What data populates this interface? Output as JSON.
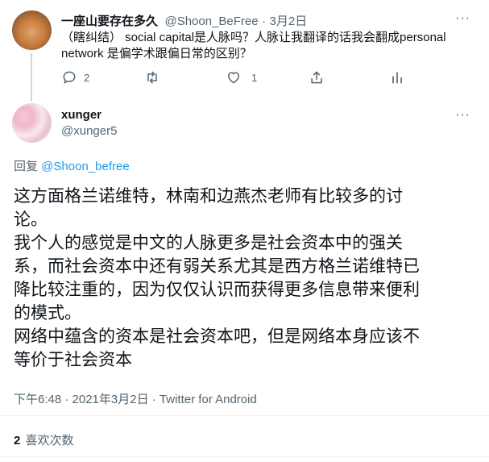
{
  "parent": {
    "display_name": "一座山要存在多久",
    "handle": "@Shoon_BeFree",
    "separator": "·",
    "date": "3月2日",
    "more": "···",
    "text_line1": "（瞎纠结） social capital是人脉吗？人脉让我翻译的话我会翻成personal",
    "text_line2": "network 是偏学术跟偏日常的区别？",
    "reply_count": "2",
    "retweet_count": "",
    "like_count": "1"
  },
  "tweet": {
    "display_name": "xunger",
    "handle": "@xunger5",
    "more": "···",
    "reply_prefix": "回复",
    "reply_to": "@Shoon_befree",
    "lines": [
      "这方面格兰诺维特，林南和边燕杰老师有比较多的讨",
      "论。",
      "我个人的感觉是中文的人脉更多是社会资本中的强关",
      "系，而社会资本中还有弱关系尤其是西方格兰诺维特已",
      "降比较注重的，因为仅仅认识而获得更多信息带来便利",
      "的模式。",
      "网络中蕴含的资本是社会资本吧，但是网络本身应该不",
      "等价于社会资本"
    ],
    "timestamp": "下午6:48 · 2021年3月2日 · Twitter for Android",
    "likes_count": "2",
    "likes_label": "喜欢次数"
  }
}
